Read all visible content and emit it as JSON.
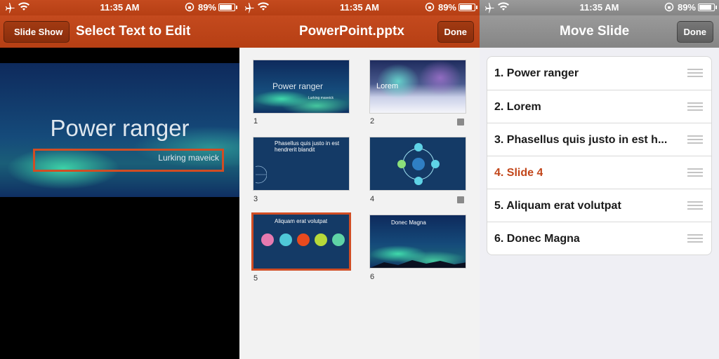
{
  "status": {
    "time": "11:35 AM",
    "battery": "89%"
  },
  "panel1": {
    "back_label": "Slide Show",
    "title": "Select Text to Edit",
    "slide_title": "Power ranger",
    "slide_subtitle": "Lurking  maveick"
  },
  "panel2": {
    "title": "PowerPoint.pptx",
    "done_label": "Done",
    "thumbs": [
      {
        "num": "1",
        "title": "Power ranger",
        "subtitle": "Lurking  maveick"
      },
      {
        "num": "2",
        "title": "Lorem"
      },
      {
        "num": "3",
        "title": "Phasellus quis justo in est hendrerit blandit"
      },
      {
        "num": "4"
      },
      {
        "num": "5",
        "title": "Aliquam erat volutpat"
      },
      {
        "num": "6",
        "title": "Donec Magna"
      }
    ]
  },
  "panel3": {
    "title": "Move Slide",
    "done_label": "Done",
    "items": [
      {
        "label": "1. Power ranger"
      },
      {
        "label": "2. Lorem"
      },
      {
        "label": "3. Phasellus quis justo in est h..."
      },
      {
        "label": "4. Slide 4"
      },
      {
        "label": "5. Aliquam erat volutpat"
      },
      {
        "label": "6. Donec Magna"
      }
    ]
  },
  "colors": {
    "accent": "#c2461a",
    "highlight": "#d14d24",
    "nav_orange": "#b63f14",
    "nav_gray": "#8a8a8a"
  },
  "icons": [
    "airplane-icon",
    "wifi-icon",
    "orientation-lock-icon",
    "battery-icon",
    "notes-icon",
    "reorder-grip-icon",
    "globe-icon"
  ]
}
